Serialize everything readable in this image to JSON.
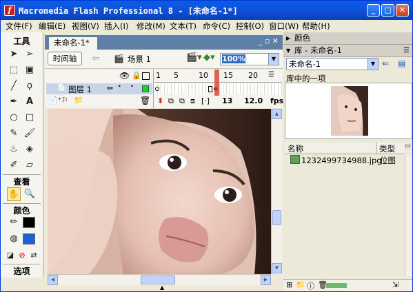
{
  "window": {
    "title": "Macromedia Flash Professional 8 - [未命名-1*]",
    "app_icon": "f"
  },
  "menu": {
    "items": [
      "文件(F)",
      "编辑(E)",
      "视图(V)",
      "插入(I)",
      "修改(M)",
      "文本(T)",
      "命令(C)",
      "控制(O)",
      "窗口(W)",
      "帮助(H)"
    ]
  },
  "tools": {
    "header": "工具",
    "view_header": "查看",
    "colors_header": "颜色",
    "options_header": "选项"
  },
  "document": {
    "tab": "未命名-1*",
    "timeline_button": "时间轴",
    "scene": "场景 1",
    "zoom": "100%"
  },
  "timeline": {
    "layer_name": "图层 1",
    "ruler": [
      "1",
      "5",
      "10",
      "15",
      "20"
    ],
    "current_frame": "13",
    "fps": "12.0",
    "fps_unit": "fps"
  },
  "panels": {
    "color_title": "颜色",
    "library_title": "库 - 未命名-1",
    "library_doc": "未命名-1",
    "library_count": "库中的一项",
    "col_name": "名称",
    "col_type": "类型",
    "item_name": "1232499734988.jpg",
    "item_type": "位图"
  }
}
